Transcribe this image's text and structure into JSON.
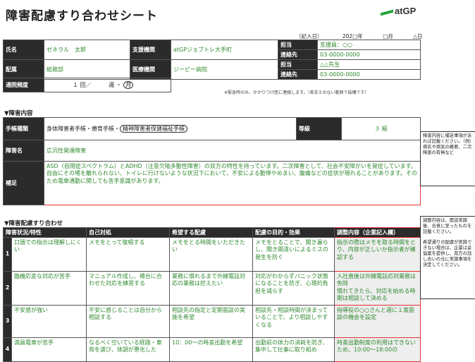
{
  "header": {
    "title": "障害配慮すり合わせシート",
    "logo_text": "atGP",
    "date_label": "（記入日）",
    "date_year": "202□年",
    "date_month": "□月",
    "date_day": "△日"
  },
  "basic": {
    "name_label": "氏名",
    "name_value": "ゼネラル　太郎",
    "org_label": "支援機関",
    "org_value": "atGPジョブトレ大手町",
    "dept_label": "配属",
    "dept_value": "総務部",
    "clinic_label": "医療機関",
    "clinic_value": "ジーピー病院",
    "contact1_label1": "担当",
    "contact1_value1": "支援員：○○",
    "contact1_label2": "連絡先",
    "contact1_value2": "03-0000-0000",
    "contact2_label1": "担当",
    "contact2_value1": "△△先生",
    "contact2_label2": "連絡先",
    "contact2_value2": "03-0000-0000",
    "visit_label": "通院頻度",
    "visit_count": "１ 回／",
    "visit_unit_week": "週",
    "visit_sep": "・",
    "visit_unit_month": "月",
    "note": "※緊急時のみ、かかりつけ医に連絡します。（差支えのない範囲で結構です）"
  },
  "disability": {
    "section_title": "▼障害内容",
    "type_label": "手帳種類",
    "type_value_1": "身体障害者手帳・療育手帳・",
    "type_value_2": "精神障害者保健福祉手帳",
    "grade_label": "等級",
    "grade_value": "３ 級",
    "name_label": "障害名",
    "name_value": "広汎性発達障害",
    "extra_label": "補足",
    "extra_value": "ASD（自閉症スペクトラム）とADHD（注意欠陥多動性障害）の双方の特性を持っています。二次障害として、社会不安障がいを発症しています。自由にその場を離れられない、トイレに行けないような状況下において、不安による動悸やめまい、腹痛などの症状が現れることがあります。そのため電車通勤に関しても苦手意識があります。",
    "comment": "障害内容に補足事項があれば記載ください。（例）病名や病気の概要、二次障害の有無など"
  },
  "matching": {
    "section_title": "▼障害配慮すり合わせ",
    "headers": [
      "障害状況/特性",
      "自己対処",
      "希望する配慮",
      "配慮の目的・効果",
      "調整内容（企業記入欄）"
    ],
    "rows": [
      {
        "num": "1",
        "cells": [
          "口頭での指示は理解しにくい",
          "メモをとって復唱する",
          "メモをとる時間をいただきたい",
          "メモをとることで、聞き漏らし、聞き間違いによるミスの発生を防ぐ",
          "指示の際はメモを取る時間をとり、内容が正しいか指示者が確認する"
        ]
      },
      {
        "num": "2",
        "cells": [
          "臨機応変な対応が苦手",
          "マニュアル作成し、場合に合わせた対応を練習する",
          "業務に慣れるまで外線電話対応の業務は控えたい",
          "対応がわからずパニック状態になることを防ぎ、心理的負担を減らす",
          "入社直後は外線電話応対業務は免除\n慣れてきたら、対応を始める時期は相談して決める"
        ]
      },
      {
        "num": "3",
        "cells": [
          "不安感が強い",
          "不安に感じることは自分から相談する",
          "相談先の指定と定期面談の実施を希望",
          "相談先・相談時間が決まっていることで、より相談しやすくなる",
          "指導役の○○さんと週に１度面談の機会を設定"
        ]
      },
      {
        "num": "4",
        "cells": [
          "満員電車が苦手",
          "なるべく空いている経路・車両を選び、体調が悪化した",
          "10：00〜の時差出勤を希望",
          "出勤前の体力の消耗を防ぎ、集中して仕事に取り組め",
          "時差出勤制度の利用はできないため、10:00〜18:00の"
        ]
      }
    ],
    "comment": "調整内容は、面談実施後、合意に至ったものを記載ください。\n\n希望通りの配慮が実施できない場合は、企業は妥協案を提供し、双方の話し合いの元に実施事項を決定してください。"
  },
  "colors": {
    "label_bg": "#2b2b2b",
    "value_text": "#2f8a2f",
    "highlight": "#e23030",
    "brand": "#1fa23a"
  }
}
